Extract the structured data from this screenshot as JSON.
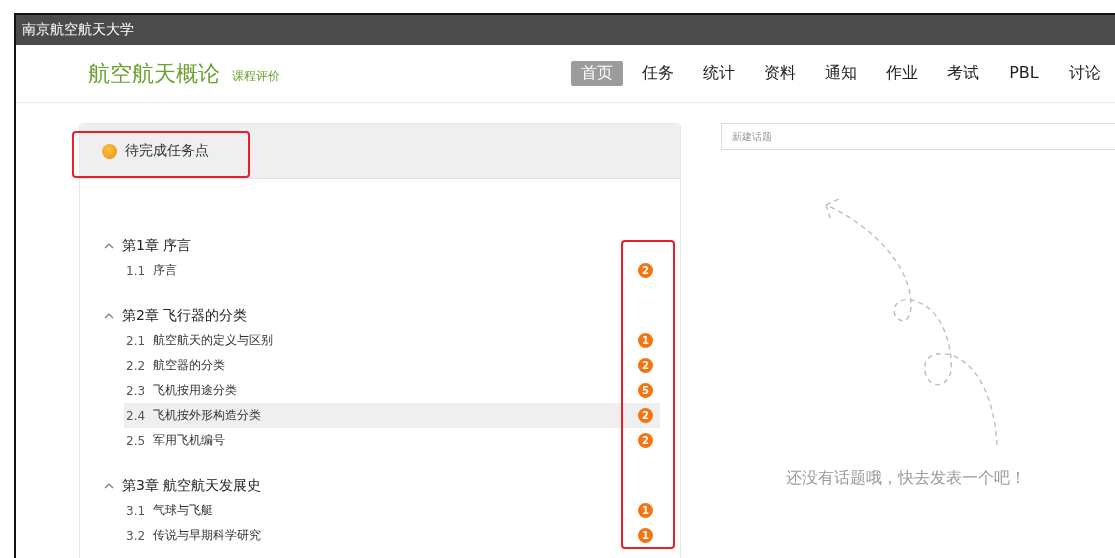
{
  "top_bar": {
    "title": "南京航空航天大学"
  },
  "header": {
    "course_title": "航空航天概论",
    "course_link": "课程评价"
  },
  "nav": [
    {
      "label": "首页",
      "selected": true
    },
    {
      "label": "任务",
      "selected": false
    },
    {
      "label": "统计",
      "selected": false
    },
    {
      "label": "资料",
      "selected": false
    },
    {
      "label": "通知",
      "selected": false
    },
    {
      "label": "作业",
      "selected": false
    },
    {
      "label": "考试",
      "selected": false
    },
    {
      "label": "PBL",
      "selected": false
    },
    {
      "label": "讨论",
      "selected": false
    }
  ],
  "task_panel": {
    "title": "待完成任务点",
    "chapters": [
      {
        "title": "第1章 序言",
        "expanded": true,
        "children": [
          {
            "number": "1.1",
            "title": "序言",
            "count": "2",
            "selected": false
          }
        ]
      },
      {
        "title": "第2章 飞行器的分类",
        "expanded": true,
        "children": [
          {
            "number": "2.1",
            "title": "航空航天的定义与区别",
            "count": "1",
            "selected": false
          },
          {
            "number": "2.2",
            "title": "航空器的分类",
            "count": "2",
            "selected": false
          },
          {
            "number": "2.3",
            "title": "飞机按用途分类",
            "count": "5",
            "selected": false
          },
          {
            "number": "2.4",
            "title": "飞机按外形构造分类",
            "count": "2",
            "selected": true
          },
          {
            "number": "2.5",
            "title": "军用飞机编号",
            "count": "2",
            "selected": false
          }
        ]
      },
      {
        "title": "第3章 航空航天发展史",
        "expanded": true,
        "children": [
          {
            "number": "3.1",
            "title": "气球与飞艇",
            "count": "1",
            "selected": false
          },
          {
            "number": "3.2",
            "title": "传说与早期科学研究",
            "count": "1",
            "selected": false
          }
        ]
      }
    ]
  },
  "discussion": {
    "placeholder": "新建话题",
    "empty_message": "还没有话题哦，快去发表一个吧！"
  }
}
